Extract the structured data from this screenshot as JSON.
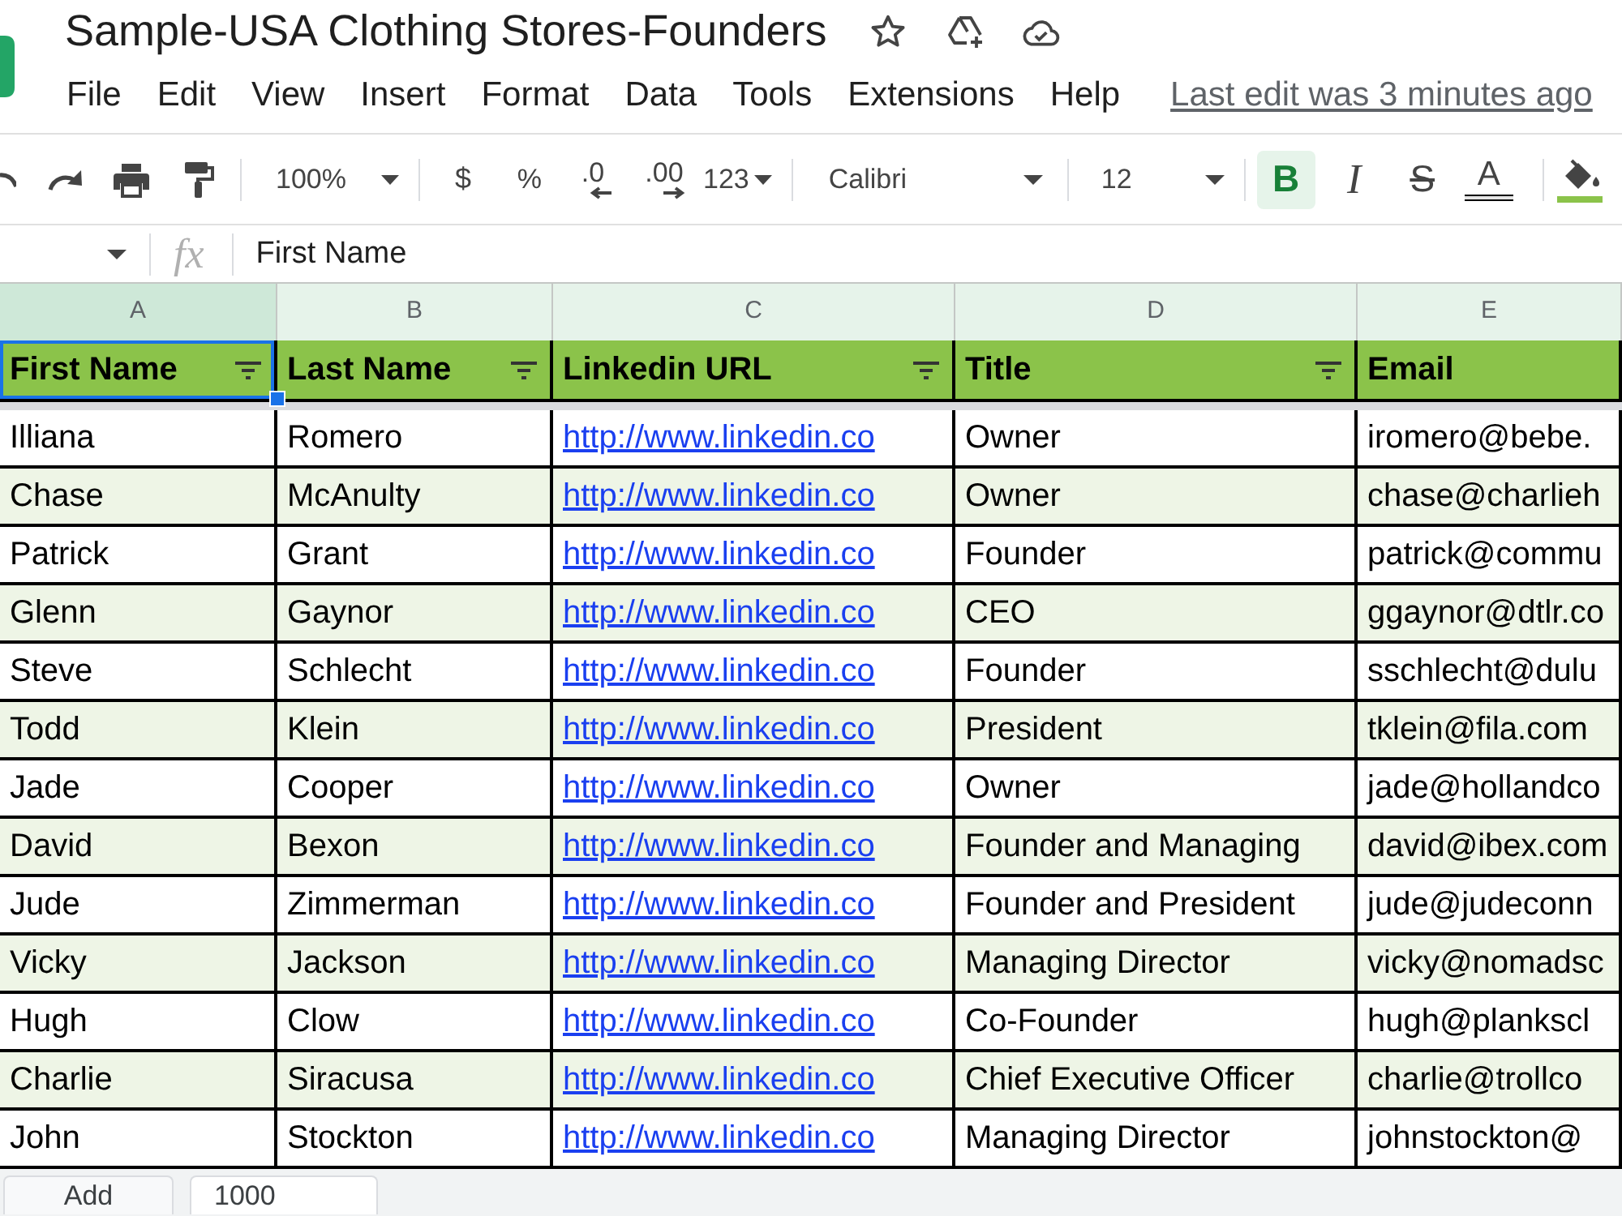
{
  "document": {
    "title": "Sample-USA Clothing Stores-Founders"
  },
  "menu": [
    "File",
    "Edit",
    "View",
    "Insert",
    "Format",
    "Data",
    "Tools",
    "Extensions",
    "Help"
  ],
  "last_edit": "Last edit was 3 minutes ago",
  "toolbar": {
    "zoom": "100%",
    "currency": "$",
    "percent": "%",
    "decrease_decimals": ".0",
    "increase_decimals": ".00",
    "more_formats": "123",
    "font": "Calibri",
    "font_size": "12",
    "styles": [
      {
        "kind": "bold",
        "label": "B",
        "on": true
      },
      {
        "kind": "italic",
        "label": "I",
        "on": false
      },
      {
        "kind": "strikethrough",
        "label": "S",
        "on": false
      }
    ],
    "text_color": "A"
  },
  "formula_bar": {
    "fx": "fx",
    "value": "First Name"
  },
  "columns": [
    {
      "letter": "A",
      "selected": true
    },
    {
      "letter": "B",
      "selected": false
    },
    {
      "letter": "C",
      "selected": false
    },
    {
      "letter": "D",
      "selected": false
    },
    {
      "letter": "E",
      "selected": false
    }
  ],
  "header_row": [
    {
      "text": "First Name",
      "filter": true,
      "selected": true
    },
    {
      "text": "Last Name",
      "filter": true,
      "selected": false
    },
    {
      "text": "Linkedin URL",
      "filter": true,
      "selected": false
    },
    {
      "text": "Title",
      "filter": true,
      "selected": false
    },
    {
      "text": "Email",
      "filter": false,
      "selected": false
    }
  ],
  "rows": [
    [
      "Illiana",
      "Romero",
      "http://www.linkedin.co",
      "Owner",
      "iromero@bebe."
    ],
    [
      "Chase",
      "McAnulty",
      "http://www.linkedin.co",
      "Owner",
      "chase@charlieh"
    ],
    [
      "Patrick",
      "Grant",
      "http://www.linkedin.co",
      "Founder",
      "patrick@commu"
    ],
    [
      "Glenn",
      "Gaynor",
      "http://www.linkedin.co",
      "CEO",
      "ggaynor@dtlr.co"
    ],
    [
      "Steve",
      "Schlecht",
      "http://www.linkedin.co",
      "Founder",
      "sschlecht@dulu"
    ],
    [
      "Todd",
      "Klein",
      "http://www.linkedin.co",
      "President",
      "tklein@fila.com"
    ],
    [
      "Jade",
      "Cooper",
      "http://www.linkedin.co",
      "Owner",
      "jade@hollandco"
    ],
    [
      "David",
      "Bexon",
      "http://www.linkedin.co",
      "Founder and Managing",
      "david@ibex.com"
    ],
    [
      "Jude",
      "Zimmerman",
      "http://www.linkedin.co",
      "Founder and President",
      "jude@judeconn"
    ],
    [
      "Vicky",
      "Jackson",
      "http://www.linkedin.co",
      "Managing Director",
      "vicky@nomadsc"
    ],
    [
      "Hugh",
      "Clow",
      "http://www.linkedin.co",
      "Co-Founder",
      "hugh@plankscl"
    ],
    [
      "Charlie",
      "Siracusa",
      "http://www.linkedin.co",
      "Chief Executive Officer",
      "charlie@trollco"
    ],
    [
      "John",
      "Stockton",
      "http://www.linkedin.co",
      "Managing Director",
      "johnstockton@"
    ]
  ],
  "add_rows": {
    "button": "Add",
    "count": "1000"
  }
}
